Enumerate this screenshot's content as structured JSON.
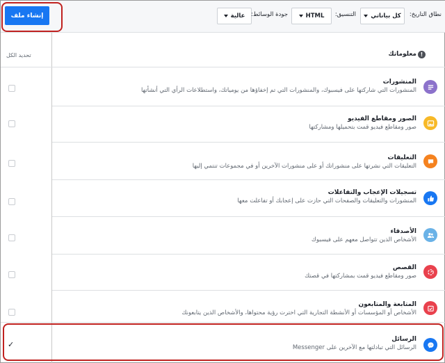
{
  "toolbar": {
    "create_file_label": "إنشاء ملف",
    "date_range_label": "نطاق التاريخ:",
    "date_range_value": "كل بياناتي",
    "format_label": "التنسيق:",
    "format_value": "HTML",
    "media_quality_label": "جودة الوسائط:",
    "media_quality_value": "عالية"
  },
  "select_all_label": "تحديد الكل",
  "section_title": "معلوماتك",
  "categories": [
    {
      "title": "المنشورات",
      "description": "المنشورات التي شاركتها على فيسبوك، والمنشورات التي تم إخفاؤها من يومياتك، واستطلاعات الرأي التي أنشأتها",
      "icon": "posts-icon",
      "color": "#8c72cb"
    },
    {
      "title": "الصور ومقاطع الفيديو",
      "description": "صور ومقاطع فيديو قمت بتحميلها ومشاركتها",
      "icon": "photos-icon",
      "color": "#f7b928"
    },
    {
      "title": "التعليقات",
      "description": "التعليقات التي نشرتها على منشوراتك أو على منشورات الآخرين أو في مجموعات تنتمي إليها",
      "icon": "comments-icon",
      "color": "#f5821f"
    },
    {
      "title": "تسجيلات الإعجاب والتفاعلات",
      "description": "المنشورات والتعليقات والصفحات التي حازت على إعجابك أو تفاعلت معها",
      "icon": "like-icon",
      "color": "#1877f2"
    },
    {
      "title": "الأصدقاء",
      "description": "الأشخاص الذين تتواصل معهم على فيسبوك",
      "icon": "friends-icon",
      "color": "#6ab2e7"
    },
    {
      "title": "القصص",
      "description": "صور ومقاطع فيديو قمت بمشاركتها في قصتك",
      "icon": "stories-icon",
      "color": "#e9414d"
    },
    {
      "title": "المتابعة والمتابعون",
      "description": "الأشخاص أو المؤسسات أو الأنشطة التجارية التي اخترت رؤية محتواها، والأشخاص الذين يتابعونك",
      "icon": "following-icon",
      "color": "#e9414d"
    },
    {
      "title": "الرسائل",
      "description": "الرسائل التي تبادلتها مع الآخرين على Messenger",
      "icon": "messenger-icon",
      "color": "#1877f2"
    }
  ],
  "messages_checked": true
}
